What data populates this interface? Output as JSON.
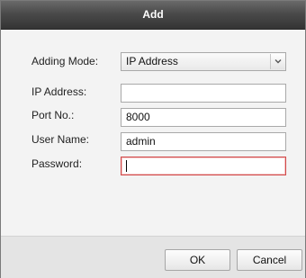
{
  "dialog": {
    "title": "Add"
  },
  "form": {
    "adding_mode": {
      "label": "Adding Mode:",
      "value": "IP Address"
    },
    "ip_address": {
      "label": "IP Address:",
      "value": ""
    },
    "port": {
      "label": "Port No.:",
      "value": "8000"
    },
    "user_name": {
      "label": "User Name:",
      "value": "admin"
    },
    "password": {
      "label": "Password:",
      "value": ""
    }
  },
  "footer": {
    "ok_label": "OK",
    "cancel_label": "Cancel"
  },
  "icons": {
    "dropdown": "chevron-down-icon"
  },
  "colors": {
    "title_bar": "#3f3f3f",
    "title_text": "#ffffff",
    "focus_border": "#d24a4a",
    "dialog_bg": "#f3f3f3",
    "footer_bg": "#e4e4e4"
  }
}
